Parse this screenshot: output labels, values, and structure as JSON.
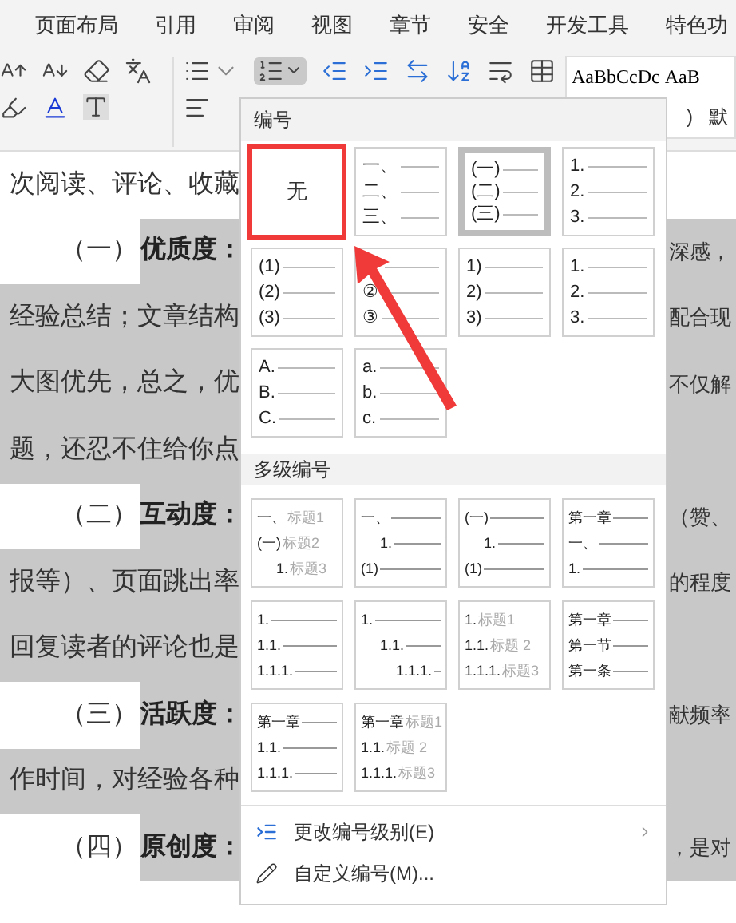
{
  "ribbon": {
    "tabs": [
      {
        "label": "页面布局",
        "selected": false
      },
      {
        "label": "引用",
        "selected": false
      },
      {
        "label": "审阅",
        "selected": false
      },
      {
        "label": "视图",
        "selected": false
      },
      {
        "label": "章节",
        "selected": false
      },
      {
        "label": "安全",
        "selected": false
      },
      {
        "label": "开发工具",
        "selected": false
      },
      {
        "label": "特色功",
        "selected": false
      }
    ],
    "style_samples": [
      "AaBbCcDc",
      "AaB"
    ],
    "style_names": [
      ")",
      "默"
    ]
  },
  "document": [
    {
      "kind": "body",
      "highlighted": false,
      "text": "次阅读、评论、收藏"
    },
    {
      "kind": "heading",
      "number": "（一）",
      "title": "优质度：",
      "right": "深感，"
    },
    {
      "kind": "body",
      "highlighted": true,
      "text": "经验总结；文章结构",
      "right": "配合现"
    },
    {
      "kind": "body",
      "highlighted": true,
      "text": "大图优先，总之，优",
      "right": "不仅解"
    },
    {
      "kind": "body",
      "highlighted": true,
      "text": "题，还忍不住给你点"
    },
    {
      "kind": "heading",
      "number": "（二）",
      "title": "互动度：",
      "right": "（赞、"
    },
    {
      "kind": "body",
      "highlighted": true,
      "text": "报等）、页面跳出率",
      "right": "的程度"
    },
    {
      "kind": "body",
      "highlighted": true,
      "text": "回复读者的评论也是"
    },
    {
      "kind": "heading",
      "number": "（三）",
      "title": "活跃度：",
      "right": "献频率"
    },
    {
      "kind": "body",
      "highlighted": true,
      "text": "作时间，对经验各种"
    },
    {
      "kind": "heading",
      "number": "（四）",
      "title": "原创度：",
      "right": "，是对"
    }
  ],
  "menu": {
    "numbering_title": "编号",
    "numbering": [
      {
        "kind": "none",
        "label": "无",
        "selected": false,
        "highlighted": true
      },
      {
        "kind": "list",
        "lines": [
          "一、",
          "二、",
          "三、"
        ],
        "selected": false,
        "highlighted": false
      },
      {
        "kind": "list",
        "lines": [
          "(一)",
          "(二)",
          "(三)"
        ],
        "selected": true,
        "highlighted": false
      },
      {
        "kind": "list",
        "lines": [
          "1.",
          "2.",
          "3."
        ],
        "selected": false,
        "highlighted": false
      },
      {
        "kind": "list",
        "lines": [
          "(1)",
          "(2)",
          "(3)"
        ],
        "selected": false,
        "highlighted": false
      },
      {
        "kind": "list",
        "lines": [
          "②",
          "③"
        ],
        "selected": false,
        "highlighted": false
      },
      {
        "kind": "list",
        "lines": [
          "1)",
          "2)",
          "3)"
        ],
        "selected": false,
        "highlighted": false
      },
      {
        "kind": "list",
        "lines": [
          "1.",
          "2.",
          "3."
        ],
        "selected": false,
        "highlighted": false
      },
      {
        "kind": "list",
        "lines": [
          "A.",
          "B.",
          "C."
        ],
        "selected": false,
        "highlighted": false
      },
      {
        "kind": "list",
        "lines": [
          "a.",
          "b.",
          "c."
        ],
        "selected": false,
        "highlighted": false
      }
    ],
    "multilevel_title": "多级编号",
    "multilevel": [
      {
        "lines": [
          {
            "label": "一、",
            "caption": "标题1"
          },
          {
            "label": "(一)",
            "caption": "标题2",
            "children": [
              {
                "label": "1.",
                "caption": "标题3"
              }
            ]
          }
        ]
      },
      {
        "lines": [
          {
            "label": "一、",
            "children": [
              {
                "label": "1."
              }
            ]
          },
          {
            "label": "(1)"
          }
        ]
      },
      {
        "lines": [
          {
            "label": "(一)",
            "children": [
              {
                "label": "1."
              }
            ]
          },
          {
            "label": "(1)"
          }
        ]
      },
      {
        "lines": [
          {
            "label": "第一章"
          },
          {
            "label": "一、"
          },
          {
            "label": "1."
          }
        ]
      },
      {
        "lines": [
          {
            "label": "1."
          },
          {
            "label": "1.1."
          },
          {
            "label": "1.1.1."
          }
        ]
      },
      {
        "lines": [
          {
            "label": "1.",
            "children": [
              {
                "label": "1.1.",
                "children": [
                  {
                    "label": "1.1.1."
                  }
                ]
              }
            ]
          }
        ]
      },
      {
        "lines": [
          {
            "label": "1.",
            "caption": "标题1"
          },
          {
            "label": "1.1.",
            "caption": "标题 2"
          },
          {
            "label": "1.1.1.",
            "caption": "标题3"
          }
        ]
      },
      {
        "lines": [
          {
            "label": "第一章"
          },
          {
            "label": "第一节"
          },
          {
            "label": "第一条"
          }
        ]
      },
      {
        "lines": [
          {
            "label": "第一章"
          },
          {
            "label": "1.1."
          },
          {
            "label": "1.1.1."
          }
        ]
      },
      {
        "lines": [
          {
            "label": "第一章",
            "caption": "标题1"
          },
          {
            "label": "1.1.",
            "caption": "标题 2"
          },
          {
            "label": "1.1.1.",
            "caption": "标题3"
          }
        ]
      }
    ],
    "commands": [
      {
        "kind": "submenu",
        "label": "更改编号级别(E)"
      },
      {
        "kind": "custom",
        "label": "自定义编号(M)..."
      }
    ]
  }
}
